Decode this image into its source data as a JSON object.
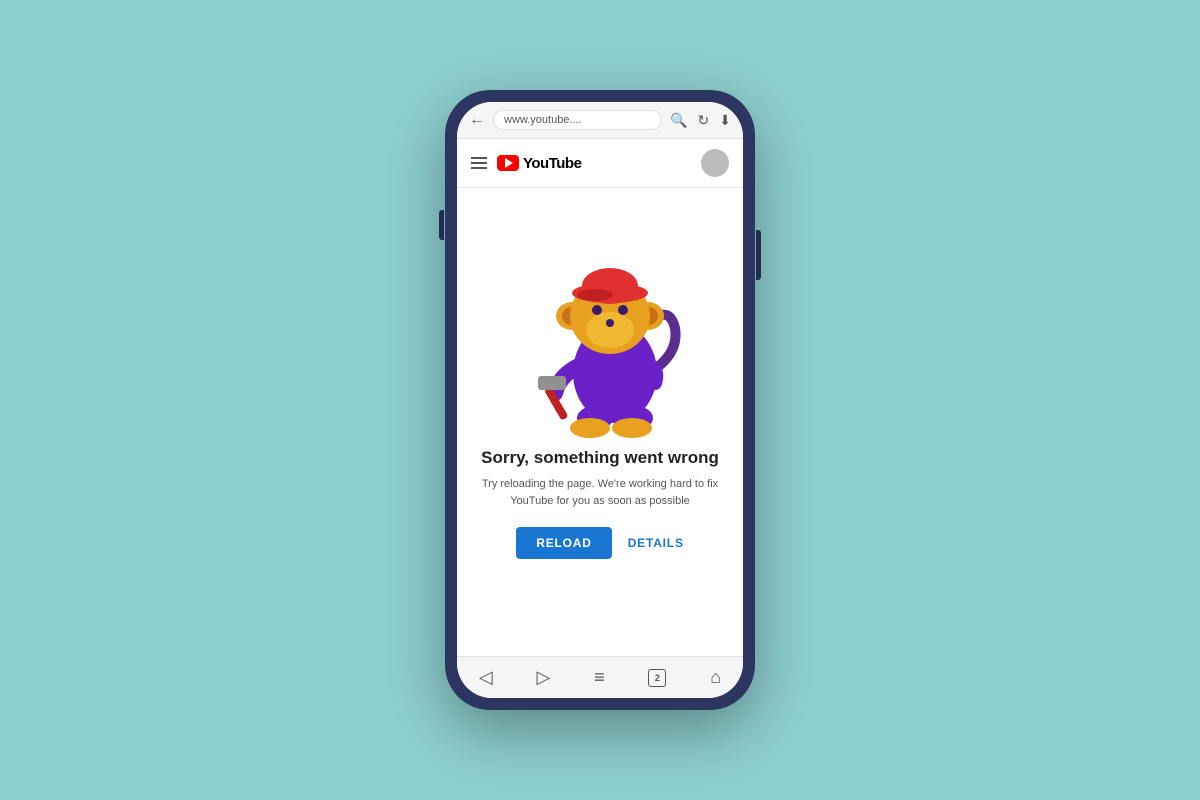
{
  "background": {
    "color": "#8ecfcf"
  },
  "phone": {
    "frame_color": "#2d3561"
  },
  "browser": {
    "url_text": "www.youtube....",
    "back_label": "←",
    "search_icon": "search",
    "refresh_icon": "refresh",
    "download_icon": "download"
  },
  "youtube_header": {
    "menu_icon": "hamburger",
    "logo_text": "YouTube",
    "avatar_color": "#bbb"
  },
  "error_page": {
    "title": "Sorry, something went wrong",
    "subtitle": "Try reloading the page. We're working hard to fix YouTube\nfor you as soon as possible",
    "reload_button_label": "RELOAD",
    "details_button_label": "DETAILS"
  },
  "bottom_nav": {
    "back_icon": "◁",
    "forward_icon": "▷",
    "menu_icon": "≡",
    "tabs_count": "2",
    "home_icon": "⌂"
  }
}
